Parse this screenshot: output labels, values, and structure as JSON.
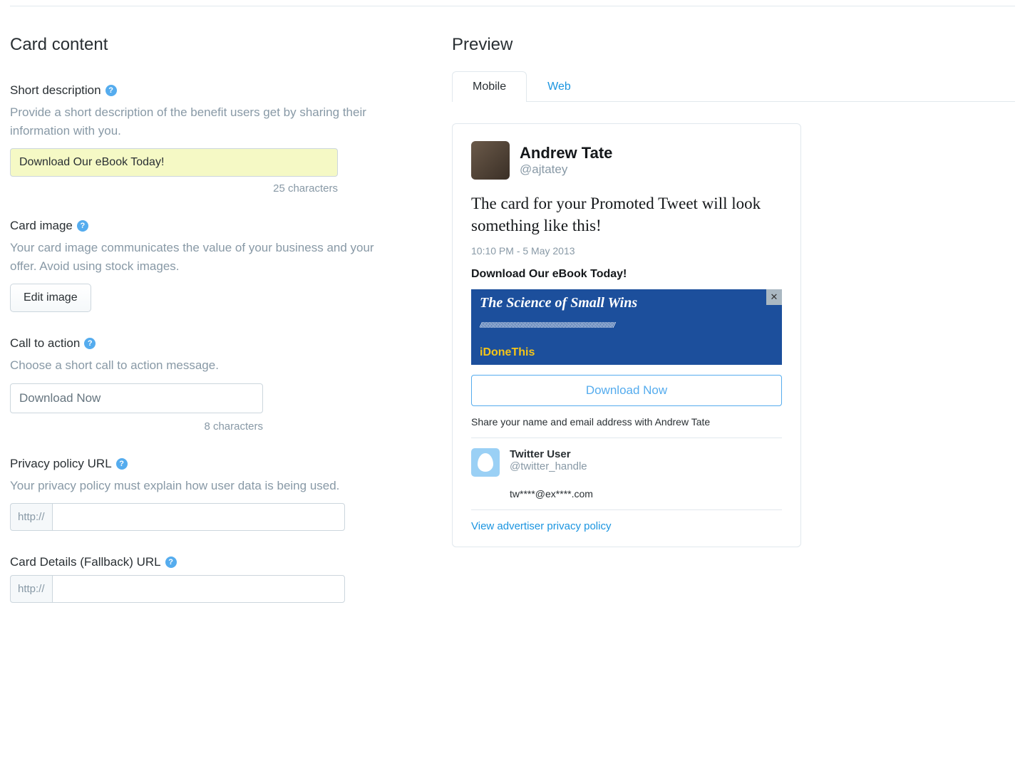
{
  "left": {
    "section_title": "Card content",
    "short_desc": {
      "label": "Short description",
      "help": "Provide a short description of the benefit users get by sharing their information with you.",
      "value": "Download Our eBook Today!",
      "char_count": "25 characters"
    },
    "card_image": {
      "label": "Card image",
      "help": "Your card image communicates the value of your business and your offer. Avoid using stock images.",
      "button": "Edit image"
    },
    "cta": {
      "label": "Call to action",
      "help": "Choose a short call to action message.",
      "value": "Download Now",
      "char_count": "8 characters"
    },
    "privacy": {
      "label": "Privacy policy URL",
      "help": "Your privacy policy must explain how user data is being used.",
      "prefix": "http://",
      "value": ""
    },
    "fallback": {
      "label": "Card Details (Fallback) URL",
      "prefix": "http://",
      "value": ""
    }
  },
  "preview": {
    "title": "Preview",
    "tabs": {
      "mobile": "Mobile",
      "web": "Web"
    },
    "author": {
      "name": "Andrew Tate",
      "handle": "@ajtatey"
    },
    "tweet_text": "The card for your Promoted Tweet will look something like this!",
    "tweet_time": "10:10 PM - 5 May 2013",
    "card_desc": "Download Our eBook Today!",
    "banner": {
      "title": "The Science of Small Wins",
      "brand": "iDoneThis"
    },
    "cta_label": "Download Now",
    "share_text": "Share your name and email address with Andrew Tate",
    "sample_user": {
      "name": "Twitter User",
      "handle": "@twitter_handle",
      "email": "tw****@ex****.com"
    },
    "policy_link": "View advertiser privacy policy"
  }
}
